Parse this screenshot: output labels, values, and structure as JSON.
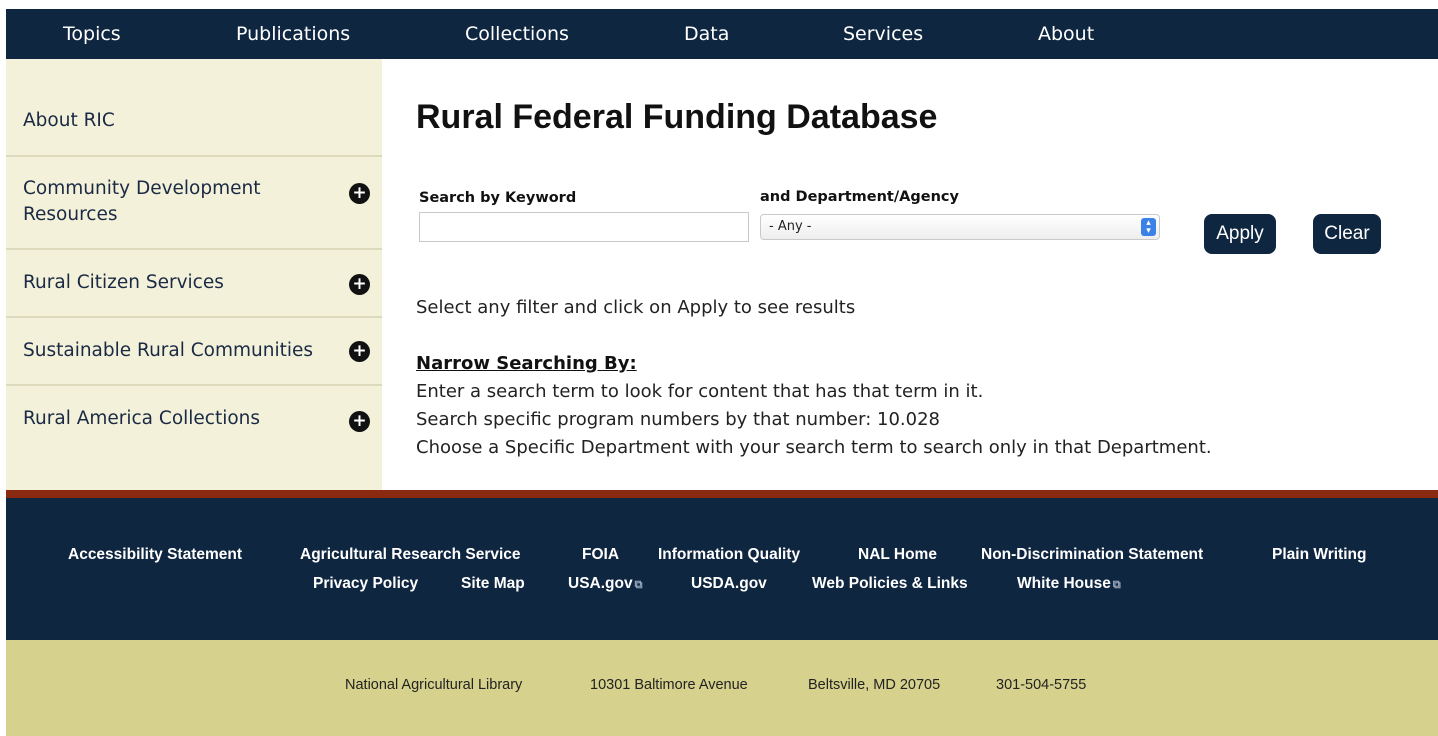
{
  "top_nav": {
    "items": [
      "Topics",
      "Publications",
      "Collections",
      "Data",
      "Services",
      "About"
    ]
  },
  "sidebar": {
    "items": [
      {
        "label": "About RIC",
        "expandable": false
      },
      {
        "label": "Community Development Resources",
        "expandable": true
      },
      {
        "label": "Rural Citizen Services",
        "expandable": true
      },
      {
        "label": "Sustainable Rural Communities",
        "expandable": true
      },
      {
        "label": "Rural America Collections",
        "expandable": true
      }
    ],
    "plus_icon": "plus-circle-icon"
  },
  "main": {
    "title": "Rural Federal Funding Database",
    "keyword_label": "Search by Keyword",
    "keyword_value": "",
    "dept_label": "and Department/Agency",
    "dept_selected": "- Any -",
    "apply_label": "Apply",
    "clear_label": "Clear",
    "instruction": "Select any filter and click on Apply to see results",
    "narrow_title": "Narrow Searching By:",
    "narrow_lines": [
      "Enter a search term to look for content that has that term in it.",
      "Search specific program numbers by that number: 10.028",
      "Choose a Specific Department with your search term to search only in that Department."
    ]
  },
  "footer": {
    "row1": [
      "Accessibility Statement",
      "Agricultural Research Service",
      "FOIA",
      "Information Quality",
      "NAL Home",
      "Non-Discrimination Statement",
      "Plain Writing"
    ],
    "row2": [
      "Privacy Policy",
      "Site Map",
      "USA.gov",
      "USDA.gov",
      "Web Policies & Links",
      "White House"
    ],
    "external_icon": "external-link-icon",
    "address": [
      "National Agricultural Library",
      "10301 Baltimore Avenue",
      "Beltsville, MD 20705",
      "301-504-5755"
    ]
  },
  "colors": {
    "navy": "#0f2640",
    "sidebar_bg": "#f3f1d9",
    "rule": "#8a2a10",
    "footer_light": "#d6d28d"
  }
}
